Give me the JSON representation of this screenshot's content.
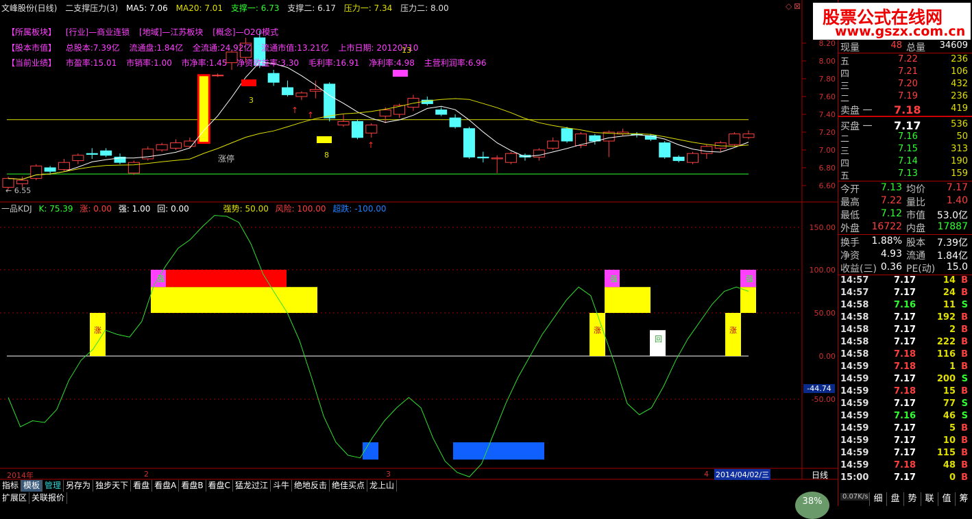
{
  "header": {
    "stock": "文峰股份(日线)",
    "indicator": "二支撑压力(3)",
    "ma5": "MA5: 7.06",
    "ma20": "MA20: 7.01",
    "support1": "支撑一: 6.73",
    "support2": "支撑二: 6.17",
    "pressure1": "压力一: 7.34",
    "pressure2": "压力二: 8.00",
    "icon_a": "◇",
    "icon_b": "⊠"
  },
  "info": {
    "row1": [
      "【所属板块】",
      "[行业]—商业连锁",
      "[地域]—江苏板块",
      "[概念]—O2O模式"
    ],
    "row2": [
      "【股本市值】",
      "总股本:7.39亿",
      "流通盘:1.84亿",
      "全流通:24.92亿",
      "流通市值:13.21亿",
      "上市日期: 20120710"
    ],
    "row3": [
      "【当前业绩】",
      "市盈率:15.01",
      "市销率:1.00",
      "市净率:1.45",
      "净资收益率:3.30",
      "毛利率:16.91",
      "净利率:4.98",
      "主营利润率:6.96"
    ]
  },
  "annotations": {
    "limit_up": "涨停",
    "low_marker": "← 6.55",
    "n3": "3",
    "n8": "8",
    "n13": "13"
  },
  "price_axis": [
    "8.20",
    "8.00",
    "7.80",
    "7.60",
    "7.40",
    "7.20",
    "7.00",
    "6.80",
    "6.60"
  ],
  "kdj_header": {
    "name": "一品KDJ",
    "k": "K: 75.39",
    "zhang": "涨: 0.00",
    "qiang": "强: 1.00",
    "hui": "回: 0.00",
    "qiangshi": "强势: 50.00",
    "fengxian": "风险: 100.00",
    "chaodie": "超跌: -100.00"
  },
  "kdj_axis": [
    "150.00",
    "100.00",
    "50.00",
    "0.00",
    "-50.00"
  ],
  "kdj_current": "-44.74",
  "kdj_markers": {
    "zhang": "涨",
    "qiang": "强",
    "hui": "回"
  },
  "bottom_dates": {
    "year": "2014年",
    "m2": "2",
    "m3": "3",
    "m4": "4",
    "cursor": "2014/04/02/三",
    "period": "日线"
  },
  "buttons": [
    "指标",
    "模板",
    "管理",
    "另存为",
    "独步天下",
    "看盘",
    "看盘A",
    "看盘B",
    "看盘C",
    "猛龙过江",
    "斗牛",
    "绝地反击",
    "绝佳买点",
    "龙上山"
  ],
  "buttons2": [
    "扩展区",
    "关联报价"
  ],
  "logo": {
    "title": "股票公式在线网",
    "url": "www.gszx.com.cn"
  },
  "quote": {
    "xianliang_label": "现量",
    "xianliang": "48",
    "zongliang_label": "总量",
    "zongliang": "34609",
    "sells": [
      {
        "label": "五",
        "price": "7.22",
        "vol": "236"
      },
      {
        "label": "四",
        "price": "7.21",
        "vol": "106"
      },
      {
        "label": "三",
        "price": "7.20",
        "vol": "432"
      },
      {
        "label": "二",
        "price": "7.19",
        "vol": "236"
      },
      {
        "label": "卖盘 一",
        "price": "7.18",
        "vol": "419"
      }
    ],
    "buys": [
      {
        "label": "买盘 一",
        "price": "7.17",
        "vol": "536"
      },
      {
        "label": "二",
        "price": "7.16",
        "vol": "50"
      },
      {
        "label": "三",
        "price": "7.15",
        "vol": "313"
      },
      {
        "label": "四",
        "price": "7.14",
        "vol": "190"
      },
      {
        "label": "五",
        "price": "7.13",
        "vol": "159"
      }
    ],
    "stats": [
      {
        "l1": "今开",
        "v1": "7.13",
        "l2": "均价",
        "v2": "7.17"
      },
      {
        "l1": "最高",
        "v1": "7.22",
        "l2": "量比",
        "v2": "1.40"
      },
      {
        "l1": "最低",
        "v1": "7.12",
        "l2": "市值",
        "v2": "53.0亿"
      },
      {
        "l1": "外盘",
        "v1": "16722",
        "l2": "内盘",
        "v2": "17887"
      }
    ],
    "fund": [
      {
        "l1": "换手",
        "v1": "1.88%",
        "l2": "股本",
        "v2": "7.39亿"
      },
      {
        "l1": "净资",
        "v1": "4.93",
        "l2": "流通",
        "v2": "1.84亿"
      },
      {
        "l1": "收益(三)",
        "v1": "0.36",
        "l2": "PE(动)",
        "v2": "15.0"
      }
    ],
    "ticks": [
      {
        "t": "14:57",
        "p": "7.17",
        "v": "14",
        "bs": "B"
      },
      {
        "t": "14:57",
        "p": "7.17",
        "v": "24",
        "bs": "B"
      },
      {
        "t": "14:58",
        "p": "7.16",
        "v": "11",
        "bs": "S"
      },
      {
        "t": "14:58",
        "p": "7.17",
        "v": "192",
        "bs": "B"
      },
      {
        "t": "14:58",
        "p": "7.17",
        "v": "2",
        "bs": "B"
      },
      {
        "t": "14:58",
        "p": "7.17",
        "v": "222",
        "bs": "B"
      },
      {
        "t": "14:58",
        "p": "7.18",
        "v": "116",
        "bs": "B"
      },
      {
        "t": "14:59",
        "p": "7.18",
        "v": "1",
        "bs": "B"
      },
      {
        "t": "14:59",
        "p": "7.17",
        "v": "200",
        "bs": "S"
      },
      {
        "t": "14:59",
        "p": "7.18",
        "v": "15",
        "bs": "B"
      },
      {
        "t": "14:59",
        "p": "7.17",
        "v": "77",
        "bs": "S"
      },
      {
        "t": "14:59",
        "p": "7.16",
        "v": "46",
        "bs": "S"
      },
      {
        "t": "14:59",
        "p": "7.17",
        "v": "5",
        "bs": "B"
      },
      {
        "t": "14:59",
        "p": "7.17",
        "v": "10",
        "bs": "B"
      },
      {
        "t": "14:59",
        "p": "7.17",
        "v": "115",
        "bs": "B"
      },
      {
        "t": "14:59",
        "p": "7.18",
        "v": "48",
        "bs": "B"
      },
      {
        "t": "15:00",
        "p": "7.17",
        "v": "0",
        "bs": "B"
      }
    ]
  },
  "status": {
    "speed": "0.07K/s",
    "percent": "38%",
    "tabs": [
      "细",
      "盘",
      "势",
      "联",
      "值",
      "筹"
    ]
  },
  "colors": {
    "up": "#ff4040",
    "down": "#30ff30",
    "candle_down": "#54fcfc",
    "bg": "#000000",
    "frame": "#aa0000"
  }
}
